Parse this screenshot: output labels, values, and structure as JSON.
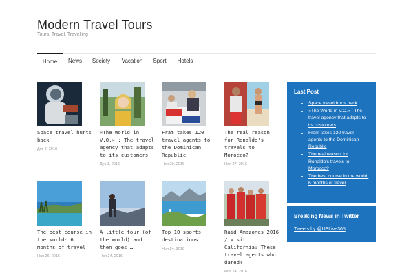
{
  "site": {
    "title": "Modern Travel Tours",
    "tagline": "Tours, Travel, Travelling"
  },
  "nav": {
    "items": [
      {
        "label": "Home"
      },
      {
        "label": "News"
      },
      {
        "label": "Society"
      },
      {
        "label": "Vacation"
      },
      {
        "label": "Sport"
      },
      {
        "label": "Hotels"
      }
    ],
    "active": "Home"
  },
  "posts": [
    {
      "title": "Space travel hurts back",
      "date": "Дек 2, 2016",
      "image": "astronaut-in-space"
    },
    {
      "title": "«The World in V.O.» : The travel agency that adapts to its customers",
      "date": "Дек 1, 2016",
      "image": "smiling-woman-outdoors"
    },
    {
      "title": "Fram takes 120 travel agents to the Dominican Republic",
      "date": "Ноя 29, 2016",
      "image": "people-at-table-with-flag"
    },
    {
      "title": "The real reason for Ronaldo's travels to Morocco?",
      "date": "Ноя 27, 2016",
      "image": "footballer-and-woman-on-beach"
    },
    {
      "title": "The best course in the world: 6 months of travel",
      "date": "Ноя 26, 2016",
      "image": "tropical-island-coast"
    },
    {
      "title": "A little tour (of the world) and then goes …",
      "date": "Ноя 24, 2016",
      "image": "person-on-mountain-at-sunset"
    },
    {
      "title": "Top 10 sports destinations",
      "date": "Ноя 24, 2016",
      "image": "mountain-lake-aerial"
    },
    {
      "title": "Raid Amazones 2016 / Visit California: These travel agents who dared!",
      "date": "Ноя 24, 2016",
      "image": "women-team-in-red"
    }
  ],
  "sidebar": {
    "last_post": {
      "title": "Last Post",
      "links": [
        "Space travel hurts back",
        "«The World in V.O.» : The travel agency that adapts to its customers",
        "Fram takes 120 travel agents to the Dominican Republic",
        "The real reason for Ronaldo's travels to Morocco?",
        "The best course in the world: 6 months of travel"
      ]
    },
    "twitter": {
      "title": "Breaking News in Twitter",
      "link": "Tweets by @USLive365"
    }
  },
  "colors": {
    "accent": "#1e73be",
    "text": "#222222",
    "muted": "#9a9a9a"
  }
}
